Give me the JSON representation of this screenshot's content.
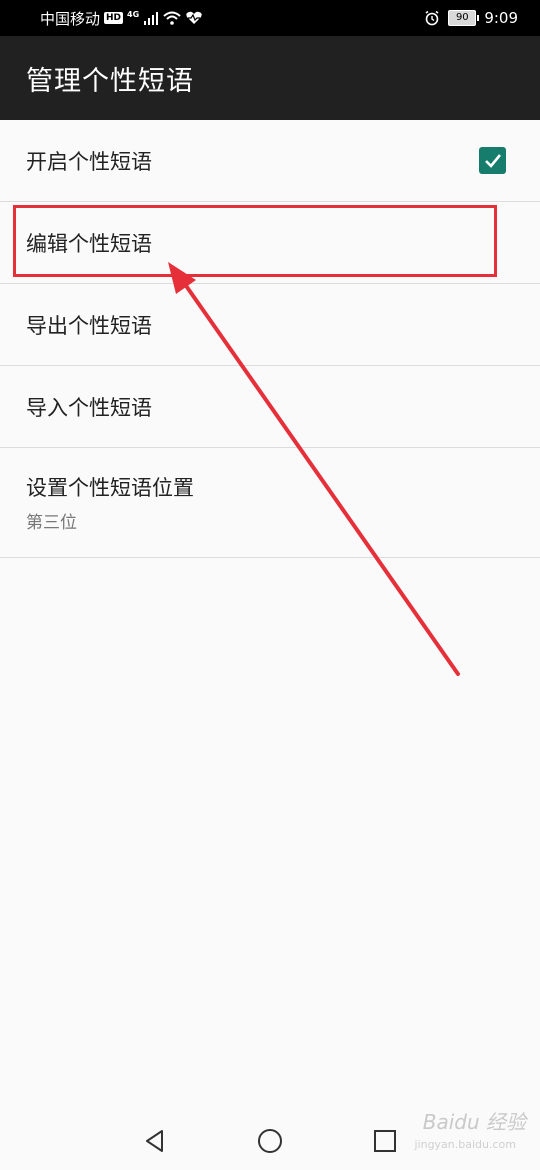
{
  "status_bar": {
    "carrier": "中国移动",
    "hd_badge": "HD",
    "network": "4G",
    "battery": "90",
    "time": "9:09"
  },
  "app_bar": {
    "title": "管理个性短语"
  },
  "preferences": [
    {
      "label": "开启个性短语",
      "checked": true
    },
    {
      "label": "编辑个性短语"
    },
    {
      "label": "导出个性短语"
    },
    {
      "label": "导入个性短语"
    },
    {
      "label": "设置个性短语位置",
      "summary": "第三位"
    }
  ],
  "watermark": {
    "brand": "Baidu 经验",
    "url": "jingyan.baidu.com"
  },
  "colors": {
    "app_bar": "#212121",
    "checkbox": "#167c6b",
    "annotation": "#e5303a"
  }
}
